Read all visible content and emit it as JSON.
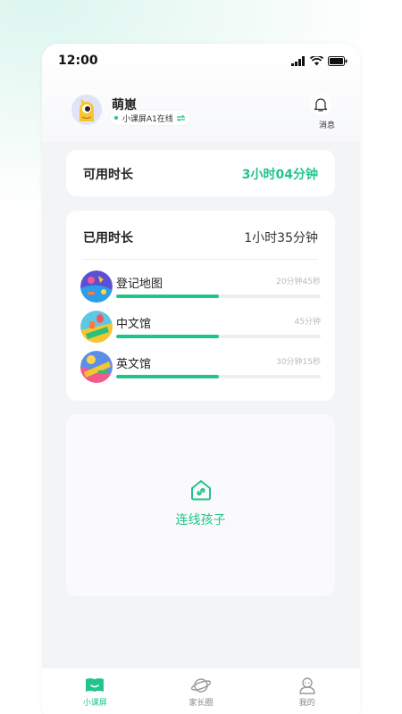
{
  "status_bar": {
    "time": "12:00"
  },
  "user": {
    "name": "萌崽",
    "device_status": "小课屏A1在线"
  },
  "header": {
    "notification_label": "消息"
  },
  "available_time": {
    "label": "可用时长",
    "value": "3小时04分钟"
  },
  "used_time": {
    "label": "已用时长",
    "value": "1小时35分钟",
    "apps": [
      {
        "name": "登记地图",
        "duration": "20分钟45秒",
        "progress": 0.5
      },
      {
        "name": "中文馆",
        "duration": "45分钟",
        "progress": 0.5
      },
      {
        "name": "英文馆",
        "duration": "30分钟15秒",
        "progress": 0.5
      }
    ]
  },
  "connect": {
    "label": "连线孩子"
  },
  "tabs": [
    {
      "label": "小课屏",
      "icon": "book-icon",
      "active": true
    },
    {
      "label": "家长圈",
      "icon": "planet-icon",
      "active": false
    },
    {
      "label": "我的",
      "icon": "profile-icon",
      "active": false
    }
  ],
  "colors": {
    "accent": "#22c48a"
  }
}
